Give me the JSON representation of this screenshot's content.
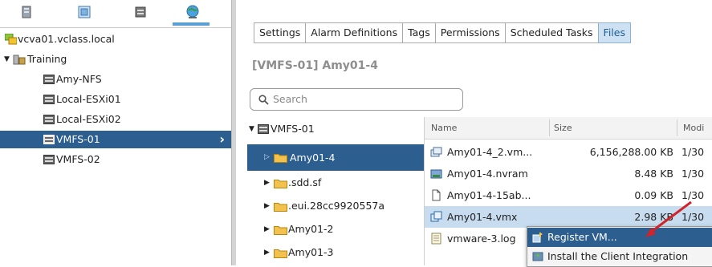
{
  "navigator": {
    "tree": {
      "root": "vcva01.vclass.local",
      "datacenter": "Training",
      "datastores": [
        "Amy-NFS",
        "Local-ESXi01",
        "Local-ESXi02",
        "VMFS-01",
        "VMFS-02"
      ]
    }
  },
  "main": {
    "tabs": [
      "Settings",
      "Alarm Definitions",
      "Tags",
      "Permissions",
      "Scheduled Tasks",
      "Files"
    ],
    "active_tab": "Files",
    "title": "[VMFS-01] Amy01-4",
    "search_placeholder": "Search",
    "folder_tree": {
      "root": "VMFS-01",
      "children": [
        "Amy01-4",
        ".sdd.sf",
        ".eui.28cc9920557a",
        "Amy01-2",
        "Amy01-3"
      ]
    },
    "files": {
      "columns": [
        "Name",
        "Size",
        "Modi"
      ],
      "rows": [
        {
          "name": "Amy01-4_2.vm...",
          "size": "6,156,288.00 KB",
          "date": "1/30"
        },
        {
          "name": "Amy01-4.nvram",
          "size": "8.48 KB",
          "date": "1/30"
        },
        {
          "name": "Amy01-4-15ab...",
          "size": "0.09 KB",
          "date": "1/30"
        },
        {
          "name": "Amy01-4.vmx",
          "size": "2.98 KB",
          "date": "1/30"
        },
        {
          "name": "vmware-3.log",
          "size": "",
          "date": ""
        }
      ]
    }
  },
  "context_menu": {
    "items": [
      "Register VM...",
      "Install the Client Integration"
    ]
  },
  "colors": {
    "selection": "#2c5e8f",
    "active_tab_bg": "#cde1f3",
    "row_highlight": "#c7dcef",
    "annotation_arrow": "#d0232a"
  }
}
